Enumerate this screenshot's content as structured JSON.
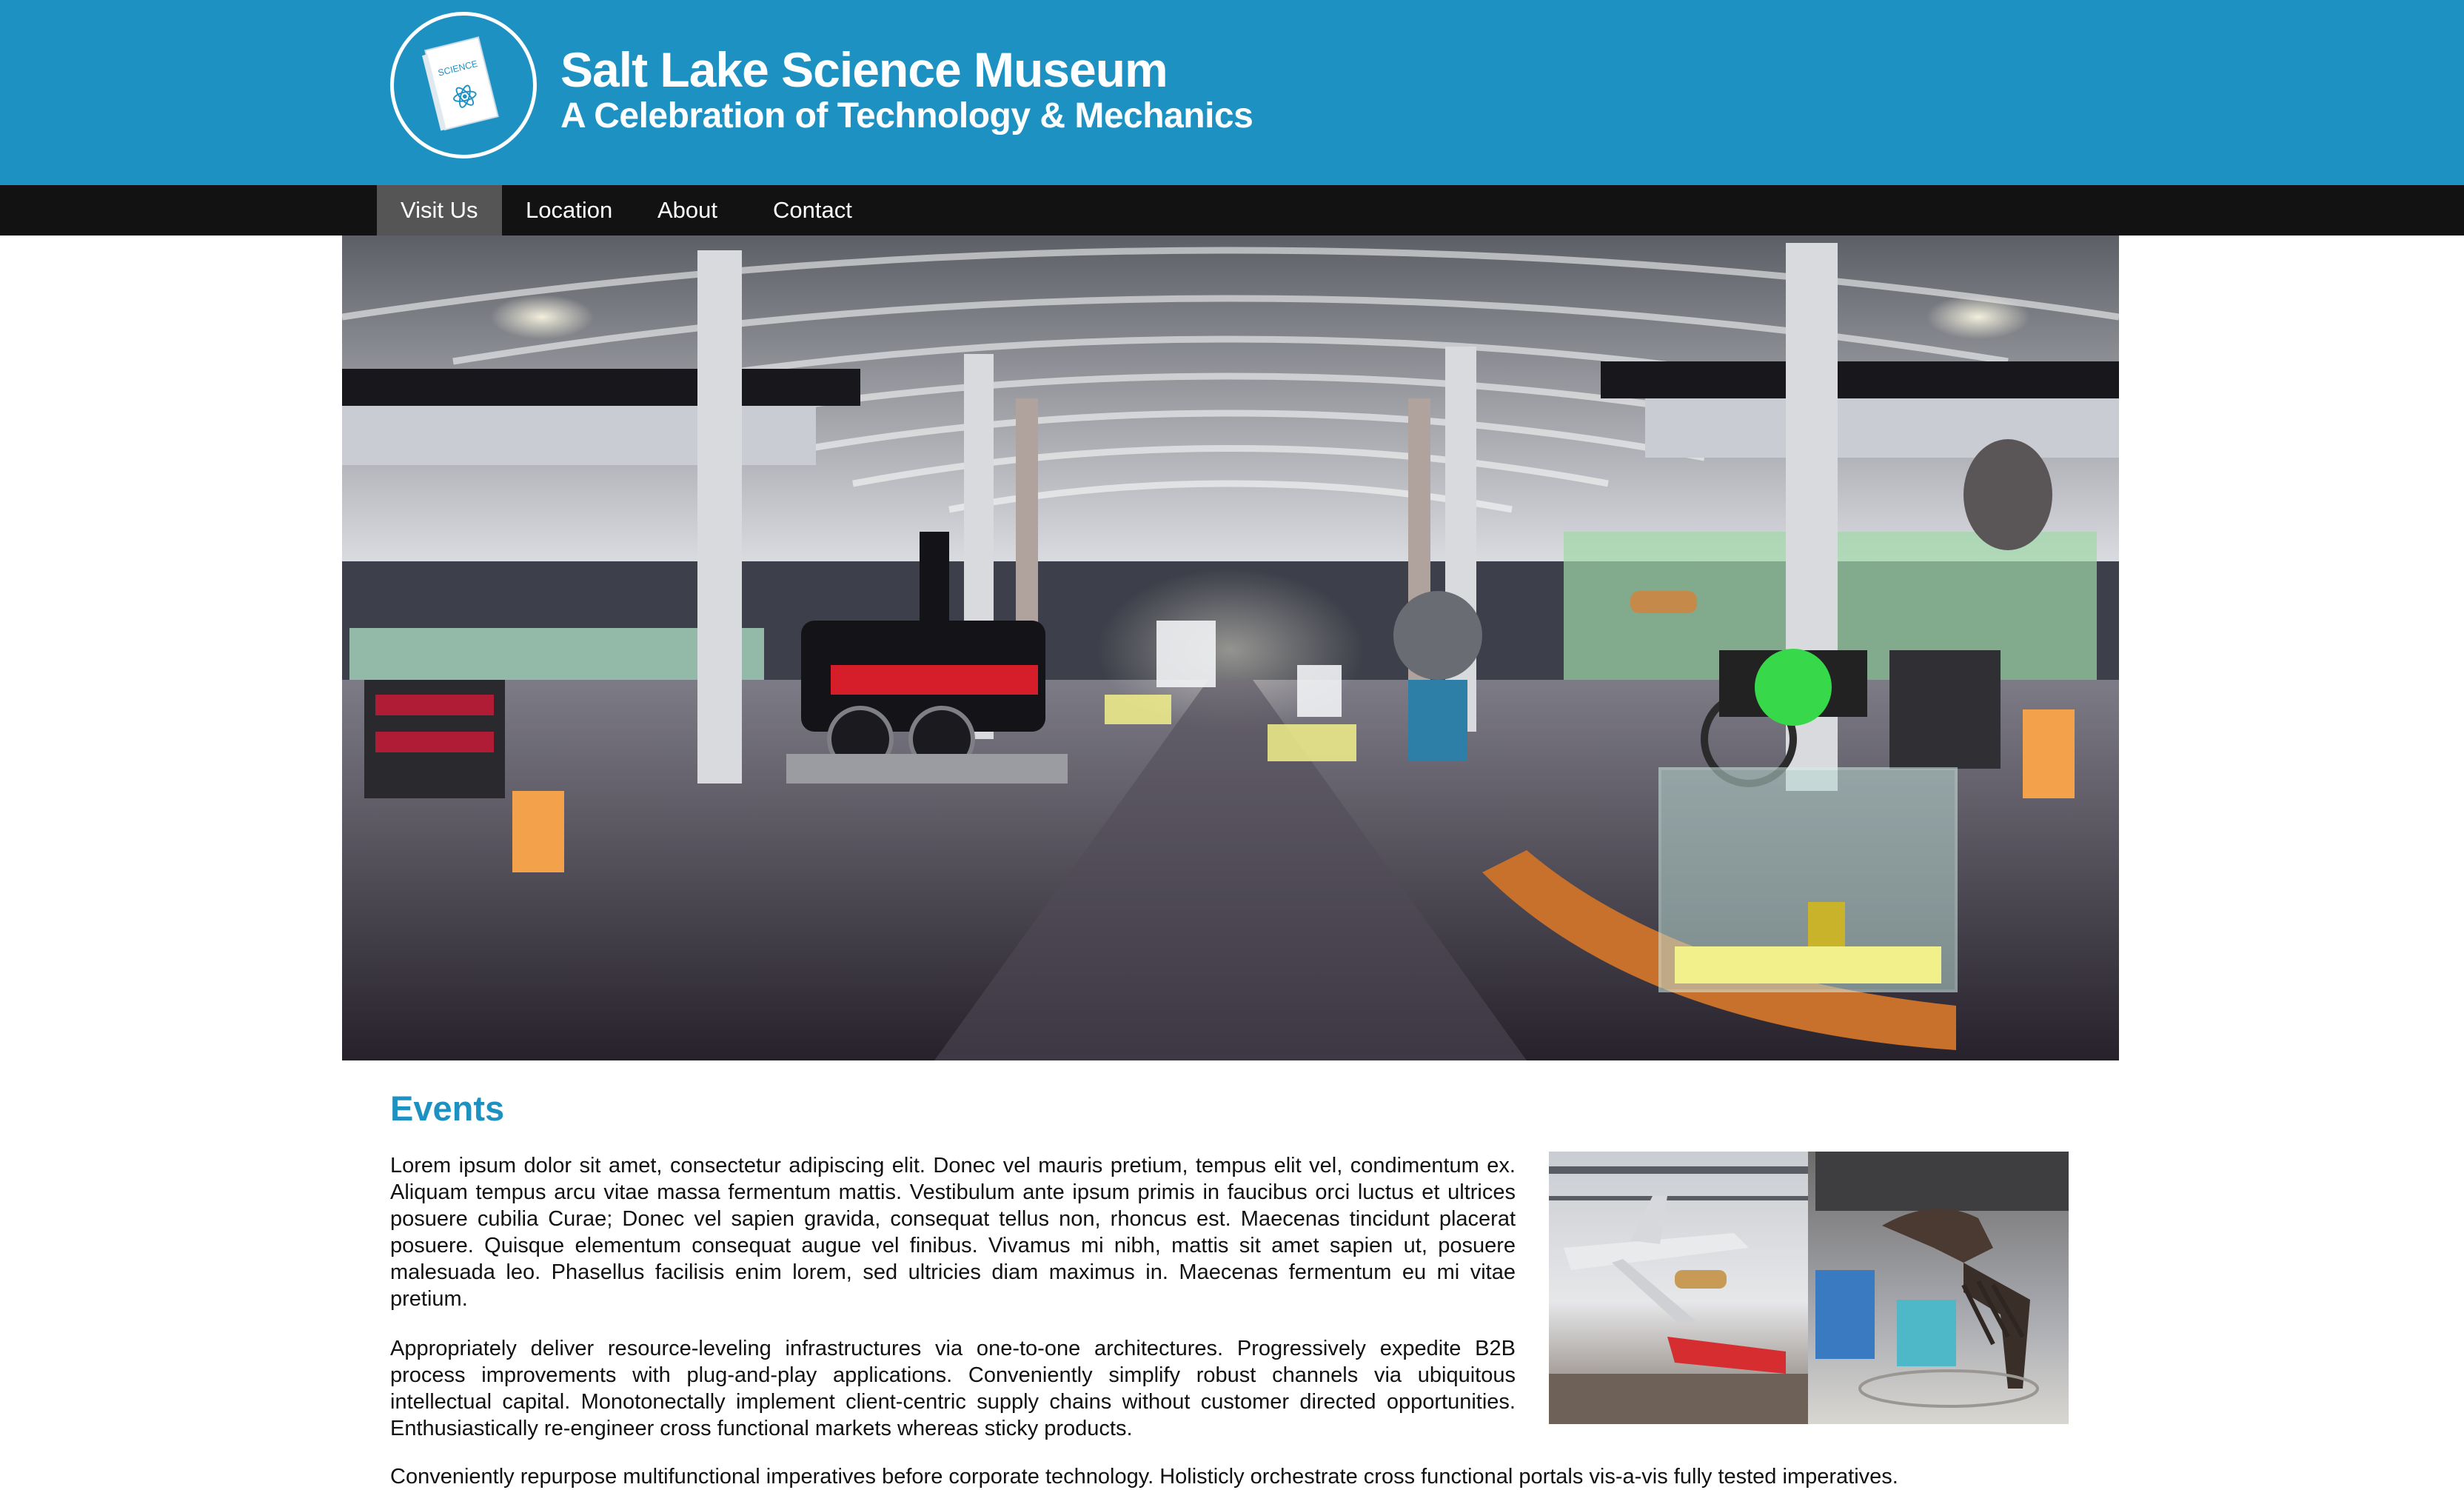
{
  "header": {
    "logo_text": "SCIENCE",
    "title": "Salt Lake Science Museum",
    "tagline": "A Celebration of Technology & Mechanics"
  },
  "nav": {
    "items": [
      {
        "label": "Visit Us",
        "active": true
      },
      {
        "label": "Location",
        "active": false
      },
      {
        "label": "About",
        "active": false
      },
      {
        "label": "Contact",
        "active": false
      }
    ]
  },
  "hero": {
    "icon": "museum-panorama-image"
  },
  "events": {
    "title": "Events",
    "paragraphs": [
      "Lorem ipsum dolor sit amet, consectetur adipiscing elit. Donec vel mauris pretium, tempus elit vel, condimentum ex. Aliquam tempus arcu vitae massa fermentum mattis. Vestibulum ante ipsum primis in faucibus orci luctus et ultrices posuere cubilia Curae; Donec vel sapien gravida, consequat tellus non, rhoncus est. Maecenas tincidunt placerat posuere. Quisque elementum consequat augue vel finibus. Vivamus mi nibh, mattis sit amet sapien ut, posuere malesuada leo. Phasellus facilisis enim lorem, sed ultricies diam maximus in. Maecenas fermentum eu mi vitae pretium.",
      "Appropriately deliver resource-leveling infrastructures via one-to-one architectures. Progressively expedite B2B process improvements with plug-and-play applications. Conveniently simplify robust channels via ubiquitous intellectual capital. Monotonectally implement client-centric supply chains without customer directed opportunities. Enthusiastically re-engineer cross functional markets whereas sticky products.",
      "Conveniently repurpose multifunctional imperatives before corporate technology. Holisticly orchestrate cross functional portals vis-a-vis fully tested imperatives."
    ],
    "image_icon": "museum-exhibits-image"
  },
  "colors": {
    "brand_blue": "#1e91c3",
    "nav_background": "#121212",
    "nav_active": "#555555"
  }
}
